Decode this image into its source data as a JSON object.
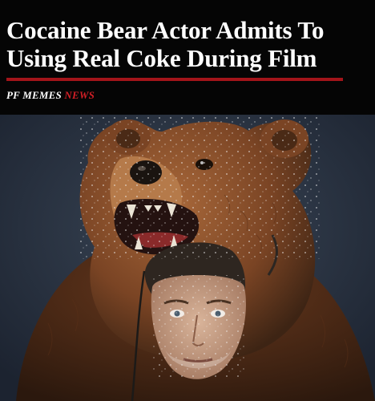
{
  "headline": {
    "line1": "Cocaine Bear Actor Admits To",
    "line2": "Using Real Coke During Film"
  },
  "brand": {
    "name": "PF MEMES",
    "accent": "NEWS",
    "accent_color": "#d21f26"
  },
  "rule_color": "#a3141a",
  "photo": {
    "subject": "man-wearing-bear-head-costume"
  }
}
